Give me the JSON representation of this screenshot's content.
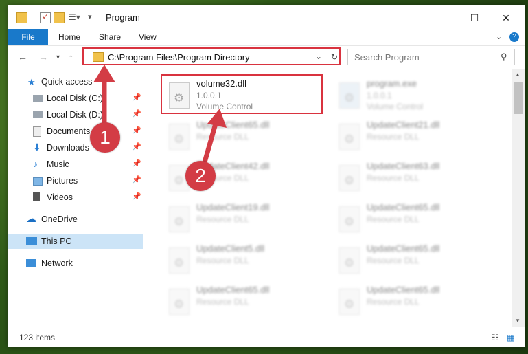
{
  "window": {
    "title": "Program",
    "controls": {
      "minimize": "—",
      "maximize": "☐",
      "close": "✕"
    }
  },
  "ribbon": {
    "tabs": [
      "File",
      "Home",
      "Share",
      "View"
    ]
  },
  "address": {
    "path": "C:\\Program Files\\Program Directory"
  },
  "search": {
    "placeholder": "Search Program"
  },
  "sidebar": {
    "items": [
      {
        "label": "Quick access",
        "icon": "star-icon"
      },
      {
        "label": "Local Disk (C:)",
        "icon": "drive-icon",
        "pinned": true
      },
      {
        "label": "Local Disk (D:)",
        "icon": "drive-icon",
        "pinned": true
      },
      {
        "label": "Documents",
        "icon": "documents-icon",
        "pinned": true
      },
      {
        "label": "Downloads",
        "icon": "download-icon",
        "pinned": true
      },
      {
        "label": "Music",
        "icon": "music-icon",
        "pinned": true
      },
      {
        "label": "Pictures",
        "icon": "pictures-icon",
        "pinned": true
      },
      {
        "label": "Videos",
        "icon": "videos-icon",
        "pinned": true
      },
      {
        "label": "OneDrive",
        "icon": "cloud-icon"
      },
      {
        "label": "This PC",
        "icon": "computer-icon",
        "selected": true
      },
      {
        "label": "Network",
        "icon": "network-icon"
      }
    ]
  },
  "files": [
    {
      "name": "volume32.dll",
      "version": "1.0.0.1",
      "desc": "Volume Control",
      "highlighted": true
    },
    {
      "name": "program.exe",
      "version": "1.0.0.1",
      "desc": "Volume Control"
    },
    {
      "name": "UpdateClient65.dll",
      "desc": "Resource DLL"
    },
    {
      "name": "UpdateClient21.dll",
      "desc": "Resource DLL"
    },
    {
      "name": "UpdateClient42.dll",
      "desc": "Resource DLL"
    },
    {
      "name": "UpdateClient63.dll",
      "desc": "Resource DLL"
    },
    {
      "name": "UpdateClient19.dll",
      "desc": "Resource DLL"
    },
    {
      "name": "UpdateClient65.dll",
      "desc": "Resource DLL"
    },
    {
      "name": "UpdateClient5.dll",
      "desc": "Resource DLL"
    },
    {
      "name": "UpdateClient65.dll",
      "desc": "Resource DLL"
    },
    {
      "name": "UpdateClient65.dll",
      "desc": "Resource DLL"
    },
    {
      "name": "UpdateClient65.dll",
      "desc": "Resource DLL"
    }
  ],
  "status": {
    "items": "123 items"
  },
  "annotations": {
    "one": "1",
    "two": "2",
    "color": "#d33c45"
  },
  "colors": {
    "accent": "#1979ca",
    "selection": "#cce4f7",
    "highlight": "#d9333f"
  }
}
